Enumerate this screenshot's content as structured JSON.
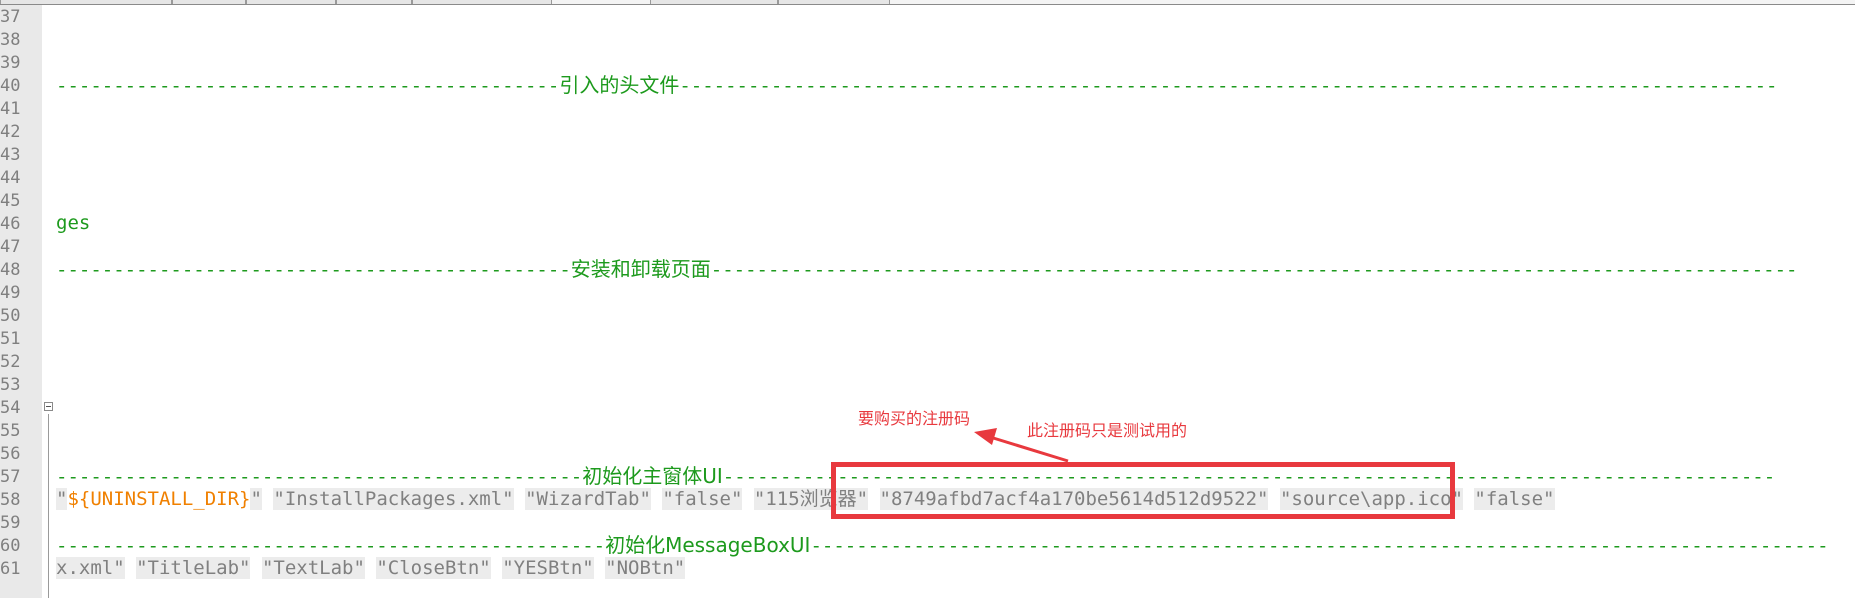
{
  "line_numbers": [
    "37",
    "38",
    "39",
    "40",
    "41",
    "42",
    "43",
    "44",
    "45",
    "46",
    "47",
    "48",
    "49",
    "50",
    "51",
    "52",
    "53",
    "54",
    "55",
    "56",
    "57",
    "58",
    "59",
    "60",
    "61"
  ],
  "lines": {
    "l40": {
      "dashes_left": "--------------------------------------------",
      "label": "引入的头文件",
      "dashes_right": "------------------------------------------------------------------------------------------------"
    },
    "l46": {
      "text": "ges"
    },
    "l48": {
      "dashes_left": "---------------------------------------------",
      "label": "安装和卸载页面",
      "dashes_right": "-----------------------------------------------------------------------------------------------"
    },
    "l57": {
      "dashes_left": "----------------------------------------------",
      "label": "初始化主窗体UI",
      "dashes_right": "--------------------------------------------------------------------------------------------"
    },
    "l58": {
      "q1": "\"",
      "var": "${UNINSTALL_DIR}",
      "q2": "\"",
      "s1": "\"InstallPackages.xml\"",
      "s2": "\"WizardTab\"",
      "s3": "\"false\"",
      "s4": "\"115浏览器\"",
      "s5": "\"8749afbd7acf4a170be5614d512d9522\"",
      "s6": "\"source\\app.ico\"",
      "s7": "\"false\""
    },
    "l60": {
      "dashes_left": "------------------------------------------------",
      "label": "初始化MessageBoxUI",
      "dashes_right": "-----------------------------------------------------------------------------------------"
    },
    "l61": {
      "s1": "x.xml\"",
      "s2": "\"TitleLab\"",
      "s3": "\"TextLab\"",
      "s4": "\"CloseBtn\"",
      "s5": "\"YESBtn\"",
      "s6": "\"NOBtn\""
    }
  },
  "annotations": {
    "buy_label": "要购买的注册码",
    "test_label": "此注册码只是测试用的"
  },
  "colors": {
    "annotation": "#e8393e",
    "comment": "#1d9a1d",
    "variable": "#f08000",
    "string_bg": "#ececec",
    "gutter_bg": "#e9e9e9"
  }
}
